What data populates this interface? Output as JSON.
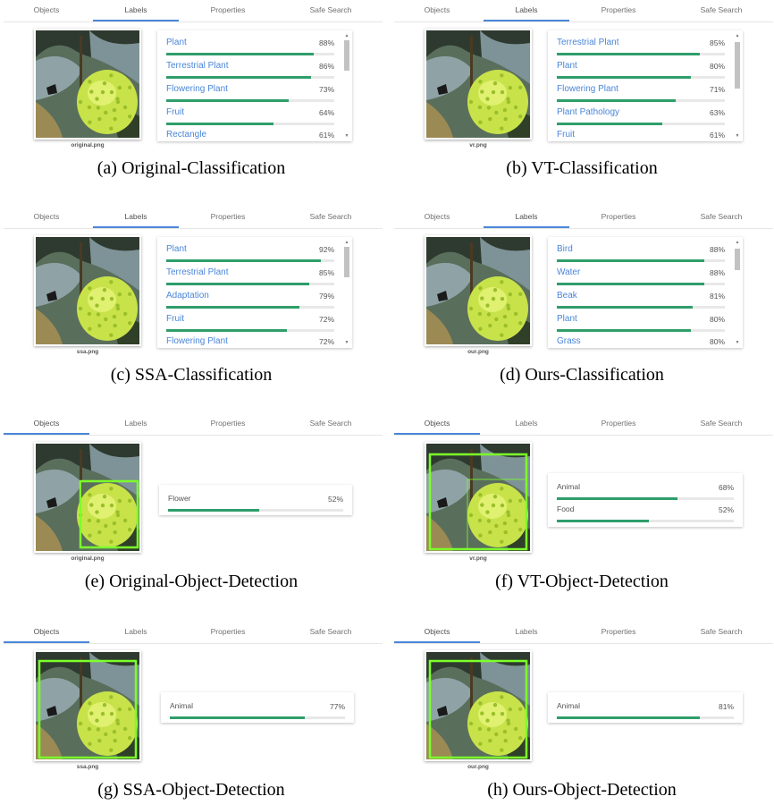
{
  "tabs": [
    "Objects",
    "Labels",
    "Properties",
    "Safe Search"
  ],
  "panels": [
    {
      "active_tab": 1,
      "file": "original.png",
      "caption": "(a) Original-Classification",
      "mode": "labels",
      "items": [
        {
          "label": "Plant",
          "pct": "88%",
          "value": 88
        },
        {
          "label": "Terrestrial Plant",
          "pct": "86%",
          "value": 86
        },
        {
          "label": "Flowering Plant",
          "pct": "73%",
          "value": 73
        },
        {
          "label": "Fruit",
          "pct": "64%",
          "value": 64
        },
        {
          "label": "Rectangle",
          "pct": "61%",
          "value": 61
        }
      ]
    },
    {
      "active_tab": 1,
      "file": "vr.png",
      "caption": "(b) VT-Classification",
      "mode": "labels",
      "items": [
        {
          "label": "Terrestrial Plant",
          "pct": "85%",
          "value": 85
        },
        {
          "label": "Plant",
          "pct": "80%",
          "value": 80
        },
        {
          "label": "Flowering Plant",
          "pct": "71%",
          "value": 71
        },
        {
          "label": "Plant Pathology",
          "pct": "63%",
          "value": 63
        },
        {
          "label": "Fruit",
          "pct": "61%",
          "value": 61
        }
      ]
    },
    {
      "active_tab": 1,
      "file": "ssa.png",
      "caption": "(c) SSA-Classification",
      "mode": "labels",
      "items": [
        {
          "label": "Plant",
          "pct": "92%",
          "value": 92
        },
        {
          "label": "Terrestrial Plant",
          "pct": "85%",
          "value": 85
        },
        {
          "label": "Adaptation",
          "pct": "79%",
          "value": 79
        },
        {
          "label": "Fruit",
          "pct": "72%",
          "value": 72
        },
        {
          "label": "Flowering Plant",
          "pct": "72%",
          "value": 72
        }
      ]
    },
    {
      "active_tab": 1,
      "file": "our.png",
      "caption": "(d) Ours-Classification",
      "mode": "labels",
      "items": [
        {
          "label": "Bird",
          "pct": "88%",
          "value": 88
        },
        {
          "label": "Water",
          "pct": "88%",
          "value": 88
        },
        {
          "label": "Beak",
          "pct": "81%",
          "value": 81
        },
        {
          "label": "Plant",
          "pct": "80%",
          "value": 80
        },
        {
          "label": "Grass",
          "pct": "80%",
          "value": 80
        }
      ]
    },
    {
      "active_tab": 0,
      "file": "original.png",
      "caption": "(e) Original-Object-Detection",
      "mode": "objects",
      "items": [
        {
          "label": "Flower",
          "pct": "52%",
          "value": 52
        }
      ]
    },
    {
      "active_tab": 0,
      "file": "vr.png",
      "caption": "(f) VT-Object-Detection",
      "mode": "objects",
      "items": [
        {
          "label": "Animal",
          "pct": "68%",
          "value": 68
        },
        {
          "label": "Food",
          "pct": "52%",
          "value": 52
        }
      ]
    },
    {
      "active_tab": 0,
      "file": "ssa.png",
      "caption": "(g) SSA-Object-Detection",
      "mode": "objects",
      "items": [
        {
          "label": "Animal",
          "pct": "77%",
          "value": 77
        }
      ]
    },
    {
      "active_tab": 0,
      "file": "our.png",
      "caption": "(h) Ours-Object-Detection",
      "mode": "objects",
      "items": [
        {
          "label": "Animal",
          "pct": "81%",
          "value": 81
        }
      ]
    }
  ],
  "colors": {
    "accent": "#4a86d8",
    "bar": "#2f9e6a",
    "box": "#7cff2a"
  },
  "icons": {
    "scroll_up": "▲",
    "scroll_down": "▼"
  }
}
